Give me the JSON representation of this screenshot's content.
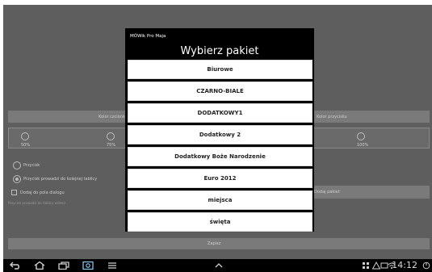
{
  "dialog": {
    "app_name": "MÓWik Pro Maja",
    "title": "Wybierz pakiet",
    "items": [
      "Biurowe",
      "CZARNO-BIALE",
      "DODATKOWY1",
      "Dodatkowy 2",
      "Dodatkowy Boże Narodzenie",
      "Euro 2012",
      "miejsca",
      "święta"
    ]
  },
  "background": {
    "left_button": "Kolor czcionki",
    "right_button": "Kolor przycisku",
    "scale_labels": [
      "50%",
      "75%",
      "100%"
    ],
    "radio_1": "Przycisk",
    "radio_2": "Przycisk prowadzi do kolejnej tablicy",
    "checkbox": "Dodaj do pola dialogu",
    "small_note": "Przycisk prowadzi do tablicy wstecz",
    "side_button": "Dodaj pakiet",
    "save_button": "Zapisz"
  },
  "status": {
    "time": "14:12"
  },
  "icons": {
    "nav": [
      "back-icon",
      "home-icon",
      "recent-apps-icon",
      "screenshot-icon",
      "menu-icon",
      "up-chevron-icon"
    ],
    "status": [
      "grid-icon",
      "warning-icon",
      "sd-card-icon",
      "wifi-icon",
      "battery-icon"
    ]
  },
  "colors": {
    "dialog_bg": "#000000",
    "item_bg": "#ffffff",
    "dim_bg": "#5e5e5e"
  }
}
